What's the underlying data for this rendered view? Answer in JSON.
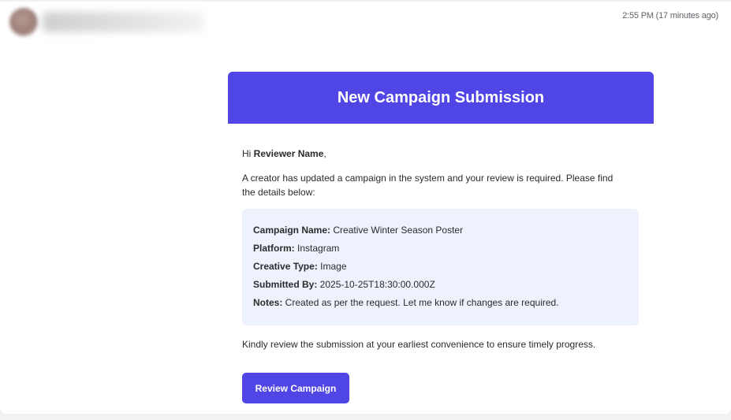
{
  "message": {
    "timestamp": "2:55 PM (17 minutes ago)"
  },
  "email": {
    "header_title": "New Campaign Submission",
    "greeting_prefix": "Hi ",
    "reviewer_name": "Reviewer Name",
    "greeting_suffix": ",",
    "intro": "A creator has updated a campaign in the system and your review is required. Please find the details below:",
    "details": [
      {
        "label": "Campaign Name:",
        "value": " Creative Winter Season Poster"
      },
      {
        "label": "Platform:",
        "value": " Instagram"
      },
      {
        "label": "Creative Type:",
        "value": " Image"
      },
      {
        "label": "Submitted By:",
        "value": " 2025-10-25T18:30:00.000Z"
      },
      {
        "label": "Notes:",
        "value": " Created as per the request. Let me know if changes are required."
      }
    ],
    "closing": "Kindly review the submission at your earliest convenience to ensure timely progress.",
    "button_label": "Review Campaign"
  },
  "colors": {
    "brand": "#4f46e5",
    "details_bg": "#eef2fd"
  }
}
